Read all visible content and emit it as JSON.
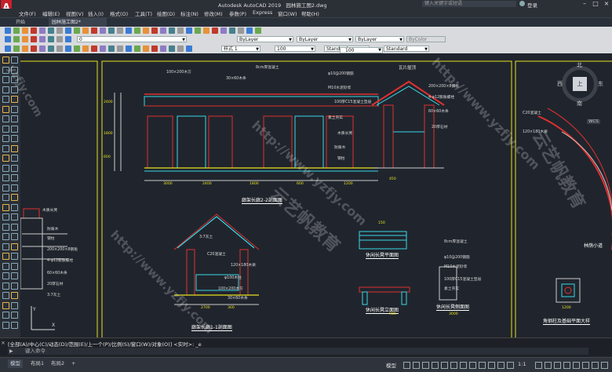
{
  "app": {
    "logo_letter": "A",
    "title": "Autodesk AutoCAD 2019",
    "filename": "园林施工图2.dwg",
    "search_placeholder": "键入关键字或短语",
    "login": "登录"
  },
  "menu": [
    "文件(F)",
    "编辑(E)",
    "视图(V)",
    "插入(I)",
    "格式(O)",
    "工具(T)",
    "绘图(D)",
    "标注(N)",
    "修改(M)",
    "参数(P)",
    "Express",
    "窗口(W)",
    "帮助(H)"
  ],
  "tabs": {
    "start": "开始",
    "document": "园林施工图2*"
  },
  "properties": {
    "layer_value": "0",
    "color": "ByLayer",
    "linetype": "ByLayer",
    "lineweight": "ByLayer",
    "plotstyle": "ByColor",
    "linetype_scale": "样式 1",
    "value_100a": "100",
    "text_style": "Standard",
    "dim_style": "Standard",
    "value_100b": "100"
  },
  "drawing": {
    "title_pavilion_section": "廊架长廊2-2剖面图",
    "title_pavilion_side": "廊架长廊1-1剖面图",
    "title_bench_plan": "休闲长凳平面图",
    "title_bench_front": "休闲长凳立面图",
    "title_bench_side": "休闲长凳侧面图",
    "title_column_detail": "角钢柱及基础平面大样",
    "title_right": "林荫小道",
    "roof_label": "瓦片屋顶",
    "annotations": [
      "100×200木方",
      "30×60木条",
      "8cm厚混凝土",
      "φ10@200钢筋",
      "M10水泥砂浆",
      "100厚C15混凝土垫层",
      "素土夯实",
      "木质长凳",
      "防腐木",
      "钢柱",
      "200×200×8钢板",
      "4-φ12膨胀螺栓",
      "60×60木条",
      "20厚石材",
      "3:7灰土",
      "C20混凝土",
      "120×180木梁",
      "φ100木柱"
    ],
    "dims": [
      "3000",
      "2400",
      "1800",
      "600",
      "1200",
      "450",
      "2700",
      "300",
      "150",
      "900"
    ]
  },
  "navcube": {
    "north": "北",
    "south": "南",
    "east": "东",
    "west": "西",
    "top": "上",
    "wcs": "WCS"
  },
  "watermarks": [
    "http://www.yzfjy.com",
    "云艺帆教育",
    "http://www.yzfjy.com",
    "yzfjy.com",
    "云艺帆教育",
    "http://www.yzfjy.com"
  ],
  "command": {
    "history": "[全部(A)/中心(C)/动态(D)/范围(E)/上一个(P)/比例(S)/窗口(W)/对象(O)] <实时>: _e",
    "prompt": "键入命令"
  },
  "status": {
    "model_tab": "模型",
    "layout1": "布局1",
    "layout2": "布局2",
    "add": "+",
    "model_space": "模型",
    "scale": "1:1"
  },
  "colors": {
    "accent_red": "#c8202a",
    "drawing_bg": "#20252d",
    "frame_yellow": "#e8e020",
    "line_cyan": "#38d8e8",
    "line_red": "#e03030"
  }
}
